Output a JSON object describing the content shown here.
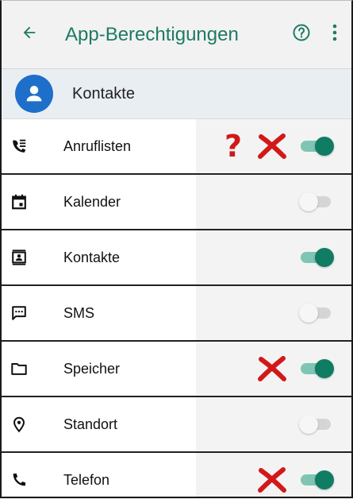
{
  "header": {
    "title": "App-Berechtigungen",
    "back_icon": "arrow-back-icon",
    "help_icon": "help-circle-icon",
    "more_icon": "more-vert-icon",
    "accent_color": "#1f7a63"
  },
  "group": {
    "title": "Kontakte",
    "avatar_icon": "person-avatar-icon",
    "avatar_color": "#1e6fc9"
  },
  "permissions": [
    {
      "label": "Anruflisten",
      "icon": "call-log-icon",
      "enabled": true,
      "question_mark": "?",
      "x_mark": true
    },
    {
      "label": "Kalender",
      "icon": "calendar-icon",
      "enabled": false,
      "question_mark": "",
      "x_mark": false
    },
    {
      "label": "Kontakte",
      "icon": "contacts-icon",
      "enabled": true,
      "question_mark": "",
      "x_mark": false
    },
    {
      "label": "SMS",
      "icon": "sms-icon",
      "enabled": false,
      "question_mark": "",
      "x_mark": false
    },
    {
      "label": "Speicher",
      "icon": "folder-icon",
      "enabled": true,
      "question_mark": "",
      "x_mark": true
    },
    {
      "label": "Standort",
      "icon": "location-icon",
      "enabled": false,
      "question_mark": "",
      "x_mark": false
    },
    {
      "label": "Telefon",
      "icon": "phone-icon",
      "enabled": true,
      "question_mark": "",
      "x_mark": true
    }
  ],
  "colors": {
    "toggle_on": "#0f7c63",
    "toggle_off": "#f6f6f6",
    "annotation_red": "#d21919"
  }
}
